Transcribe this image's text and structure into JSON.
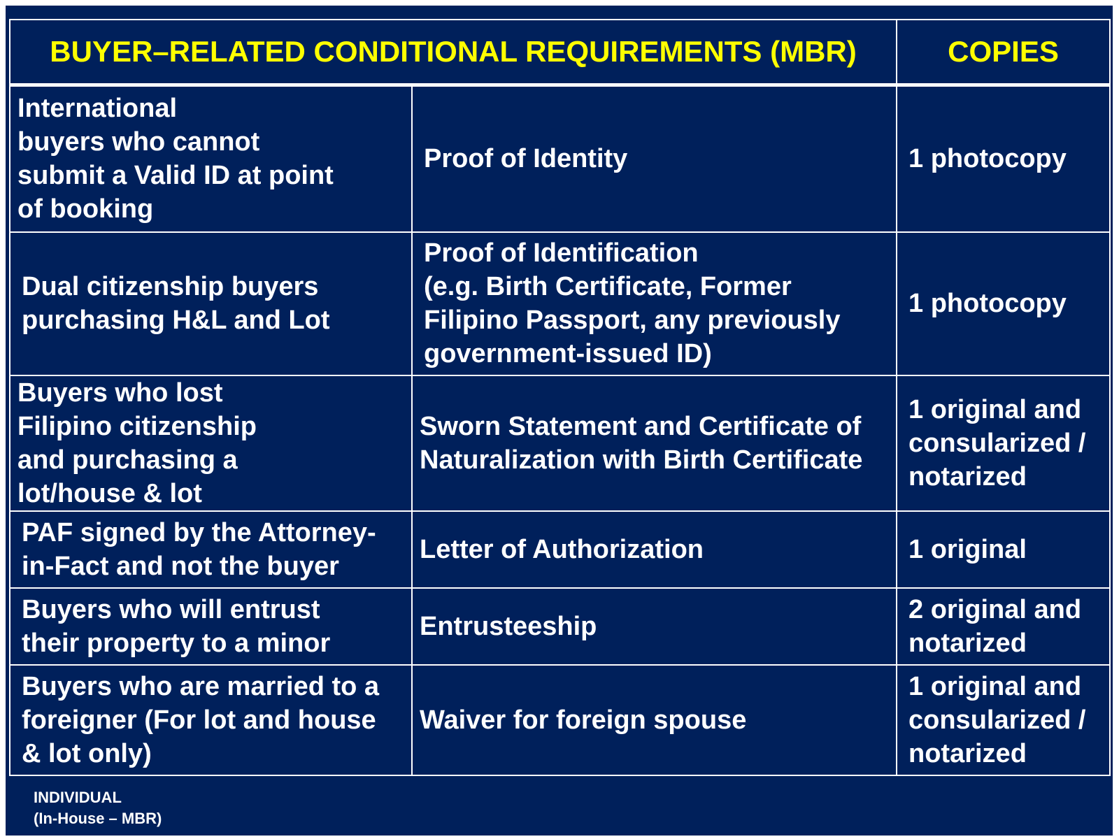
{
  "header": {
    "title": "BUYER–RELATED CONDITIONAL REQUIREMENTS (MBR)",
    "copies": "COPIES"
  },
  "rows": [
    {
      "condition": "International\nbuyers who cannot\nsubmit a Valid ID at point\nof booking",
      "requirement": "Proof of Identity",
      "copies": "1 photocopy"
    },
    {
      "condition": "Dual citizenship buyers\npurchasing H&L and Lot",
      "requirement": "Proof of  Identification\n(e.g. Birth Certificate, Former\nFilipino Passport, any previously\ngovernment-issued ID)",
      "copies": "1 photocopy"
    },
    {
      "condition": "Buyers who lost\nFilipino citizenship\nand purchasing a\nlot/house & lot",
      "requirement": "Sworn Statement and Certificate of\nNaturalization with Birth Certificate",
      "copies": "1 original and\nconsularized /\nnotarized"
    },
    {
      "condition": "PAF signed by the Attorney-\nin-Fact and not the buyer",
      "requirement": "Letter of Authorization",
      "copies": "1 original"
    },
    {
      "condition": "Buyers who will entrust\ntheir property to a minor",
      "requirement": "Entrusteeship",
      "copies": "2 original and\nnotarized"
    },
    {
      "condition": "Buyers who are married to a\nforeigner (For lot and house\n& lot only)",
      "requirement": "Waiver for foreign spouse",
      "copies": "1 original and\nconsularized /\nnotarized"
    }
  ],
  "footer": {
    "line1": "INDIVIDUAL",
    "line2": "(In-House – MBR)"
  },
  "colors": {
    "background": "#00205b",
    "header_text": "#ffff00",
    "body_text": "#ffffff",
    "border": "#ffffff"
  }
}
